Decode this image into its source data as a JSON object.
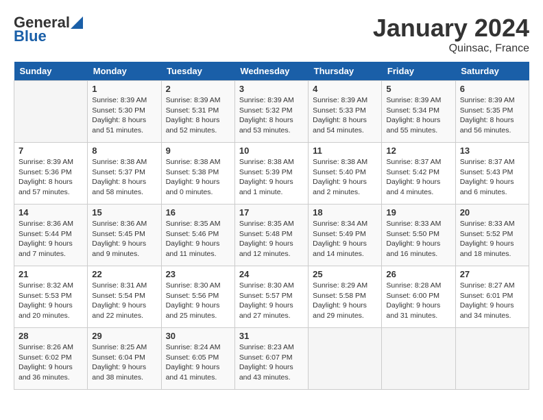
{
  "header": {
    "logo_general": "General",
    "logo_blue": "Blue",
    "title": "January 2024",
    "subtitle": "Quinsac, France"
  },
  "days": [
    "Sunday",
    "Monday",
    "Tuesday",
    "Wednesday",
    "Thursday",
    "Friday",
    "Saturday"
  ],
  "weeks": [
    [
      {
        "num": "",
        "info": ""
      },
      {
        "num": "1",
        "info": "Sunrise: 8:39 AM\nSunset: 5:30 PM\nDaylight: 8 hours\nand 51 minutes."
      },
      {
        "num": "2",
        "info": "Sunrise: 8:39 AM\nSunset: 5:31 PM\nDaylight: 8 hours\nand 52 minutes."
      },
      {
        "num": "3",
        "info": "Sunrise: 8:39 AM\nSunset: 5:32 PM\nDaylight: 8 hours\nand 53 minutes."
      },
      {
        "num": "4",
        "info": "Sunrise: 8:39 AM\nSunset: 5:33 PM\nDaylight: 8 hours\nand 54 minutes."
      },
      {
        "num": "5",
        "info": "Sunrise: 8:39 AM\nSunset: 5:34 PM\nDaylight: 8 hours\nand 55 minutes."
      },
      {
        "num": "6",
        "info": "Sunrise: 8:39 AM\nSunset: 5:35 PM\nDaylight: 8 hours\nand 56 minutes."
      }
    ],
    [
      {
        "num": "7",
        "info": "Sunrise: 8:39 AM\nSunset: 5:36 PM\nDaylight: 8 hours\nand 57 minutes."
      },
      {
        "num": "8",
        "info": "Sunrise: 8:38 AM\nSunset: 5:37 PM\nDaylight: 8 hours\nand 58 minutes."
      },
      {
        "num": "9",
        "info": "Sunrise: 8:38 AM\nSunset: 5:38 PM\nDaylight: 9 hours\nand 0 minutes."
      },
      {
        "num": "10",
        "info": "Sunrise: 8:38 AM\nSunset: 5:39 PM\nDaylight: 9 hours\nand 1 minute."
      },
      {
        "num": "11",
        "info": "Sunrise: 8:38 AM\nSunset: 5:40 PM\nDaylight: 9 hours\nand 2 minutes."
      },
      {
        "num": "12",
        "info": "Sunrise: 8:37 AM\nSunset: 5:42 PM\nDaylight: 9 hours\nand 4 minutes."
      },
      {
        "num": "13",
        "info": "Sunrise: 8:37 AM\nSunset: 5:43 PM\nDaylight: 9 hours\nand 6 minutes."
      }
    ],
    [
      {
        "num": "14",
        "info": "Sunrise: 8:36 AM\nSunset: 5:44 PM\nDaylight: 9 hours\nand 7 minutes."
      },
      {
        "num": "15",
        "info": "Sunrise: 8:36 AM\nSunset: 5:45 PM\nDaylight: 9 hours\nand 9 minutes."
      },
      {
        "num": "16",
        "info": "Sunrise: 8:35 AM\nSunset: 5:46 PM\nDaylight: 9 hours\nand 11 minutes."
      },
      {
        "num": "17",
        "info": "Sunrise: 8:35 AM\nSunset: 5:48 PM\nDaylight: 9 hours\nand 12 minutes."
      },
      {
        "num": "18",
        "info": "Sunrise: 8:34 AM\nSunset: 5:49 PM\nDaylight: 9 hours\nand 14 minutes."
      },
      {
        "num": "19",
        "info": "Sunrise: 8:33 AM\nSunset: 5:50 PM\nDaylight: 9 hours\nand 16 minutes."
      },
      {
        "num": "20",
        "info": "Sunrise: 8:33 AM\nSunset: 5:52 PM\nDaylight: 9 hours\nand 18 minutes."
      }
    ],
    [
      {
        "num": "21",
        "info": "Sunrise: 8:32 AM\nSunset: 5:53 PM\nDaylight: 9 hours\nand 20 minutes."
      },
      {
        "num": "22",
        "info": "Sunrise: 8:31 AM\nSunset: 5:54 PM\nDaylight: 9 hours\nand 22 minutes."
      },
      {
        "num": "23",
        "info": "Sunrise: 8:30 AM\nSunset: 5:56 PM\nDaylight: 9 hours\nand 25 minutes."
      },
      {
        "num": "24",
        "info": "Sunrise: 8:30 AM\nSunset: 5:57 PM\nDaylight: 9 hours\nand 27 minutes."
      },
      {
        "num": "25",
        "info": "Sunrise: 8:29 AM\nSunset: 5:58 PM\nDaylight: 9 hours\nand 29 minutes."
      },
      {
        "num": "26",
        "info": "Sunrise: 8:28 AM\nSunset: 6:00 PM\nDaylight: 9 hours\nand 31 minutes."
      },
      {
        "num": "27",
        "info": "Sunrise: 8:27 AM\nSunset: 6:01 PM\nDaylight: 9 hours\nand 34 minutes."
      }
    ],
    [
      {
        "num": "28",
        "info": "Sunrise: 8:26 AM\nSunset: 6:02 PM\nDaylight: 9 hours\nand 36 minutes."
      },
      {
        "num": "29",
        "info": "Sunrise: 8:25 AM\nSunset: 6:04 PM\nDaylight: 9 hours\nand 38 minutes."
      },
      {
        "num": "30",
        "info": "Sunrise: 8:24 AM\nSunset: 6:05 PM\nDaylight: 9 hours\nand 41 minutes."
      },
      {
        "num": "31",
        "info": "Sunrise: 8:23 AM\nSunset: 6:07 PM\nDaylight: 9 hours\nand 43 minutes."
      },
      {
        "num": "",
        "info": ""
      },
      {
        "num": "",
        "info": ""
      },
      {
        "num": "",
        "info": ""
      }
    ]
  ]
}
